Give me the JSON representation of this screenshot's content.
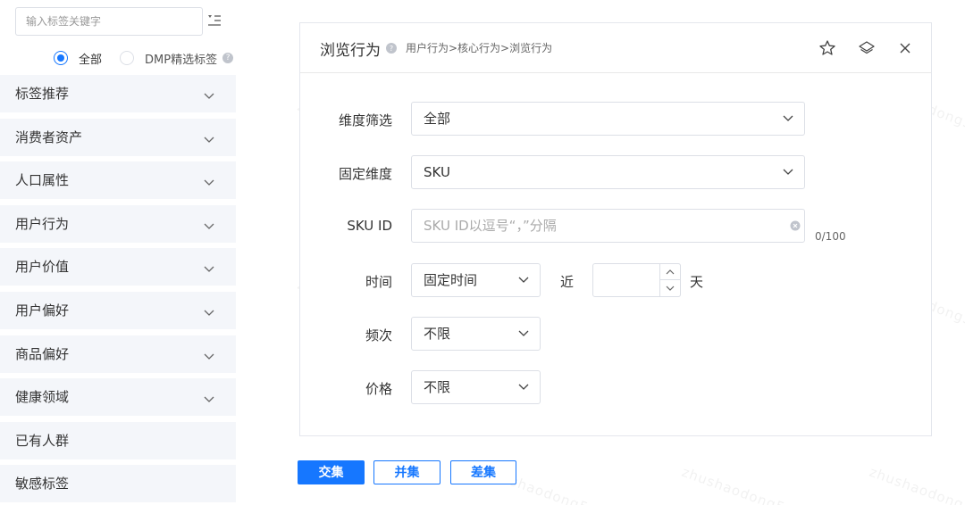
{
  "sidebar": {
    "search_placeholder": "输入标签关键字",
    "radios": [
      {
        "label": "全部",
        "selected": true
      },
      {
        "label": "DMP精选标签",
        "selected": false
      }
    ],
    "items": [
      {
        "label": "标签推荐",
        "expandable": true
      },
      {
        "label": "消费者资产",
        "expandable": true
      },
      {
        "label": "人口属性",
        "expandable": true
      },
      {
        "label": "用户行为",
        "expandable": true
      },
      {
        "label": "用户价值",
        "expandable": true
      },
      {
        "label": "用户偏好",
        "expandable": true
      },
      {
        "label": "商品偏好",
        "expandable": true
      },
      {
        "label": "健康领域",
        "expandable": true
      },
      {
        "label": "已有人群",
        "expandable": false
      },
      {
        "label": "敏感标签",
        "expandable": false
      }
    ]
  },
  "panel": {
    "title": "浏览行为",
    "breadcrumb": "用户行为>核心行为>浏览行为",
    "header_icons": [
      "star-icon",
      "layers-icon",
      "close-icon"
    ],
    "fields": {
      "dimension_filter": {
        "label": "维度筛选",
        "value": "全部"
      },
      "fixed_dimension": {
        "label": "固定维度",
        "value": "SKU"
      },
      "sku_id": {
        "label": "SKU ID",
        "placeholder": "SKU ID以逗号“，”分隔",
        "counter": "0/100"
      },
      "time": {
        "label": "时间",
        "value": "固定时间",
        "near_label": "近",
        "unit_label": "天",
        "days_value": ""
      },
      "frequency": {
        "label": "频次",
        "value": "不限"
      },
      "price": {
        "label": "价格",
        "value": "不限"
      }
    }
  },
  "actions": {
    "intersection": "交集",
    "union": "并集",
    "difference": "差集"
  },
  "colors": {
    "accent": "#1677ff",
    "sidebar_item_bg": "#f4f6fa",
    "border": "#dcdfe6"
  }
}
